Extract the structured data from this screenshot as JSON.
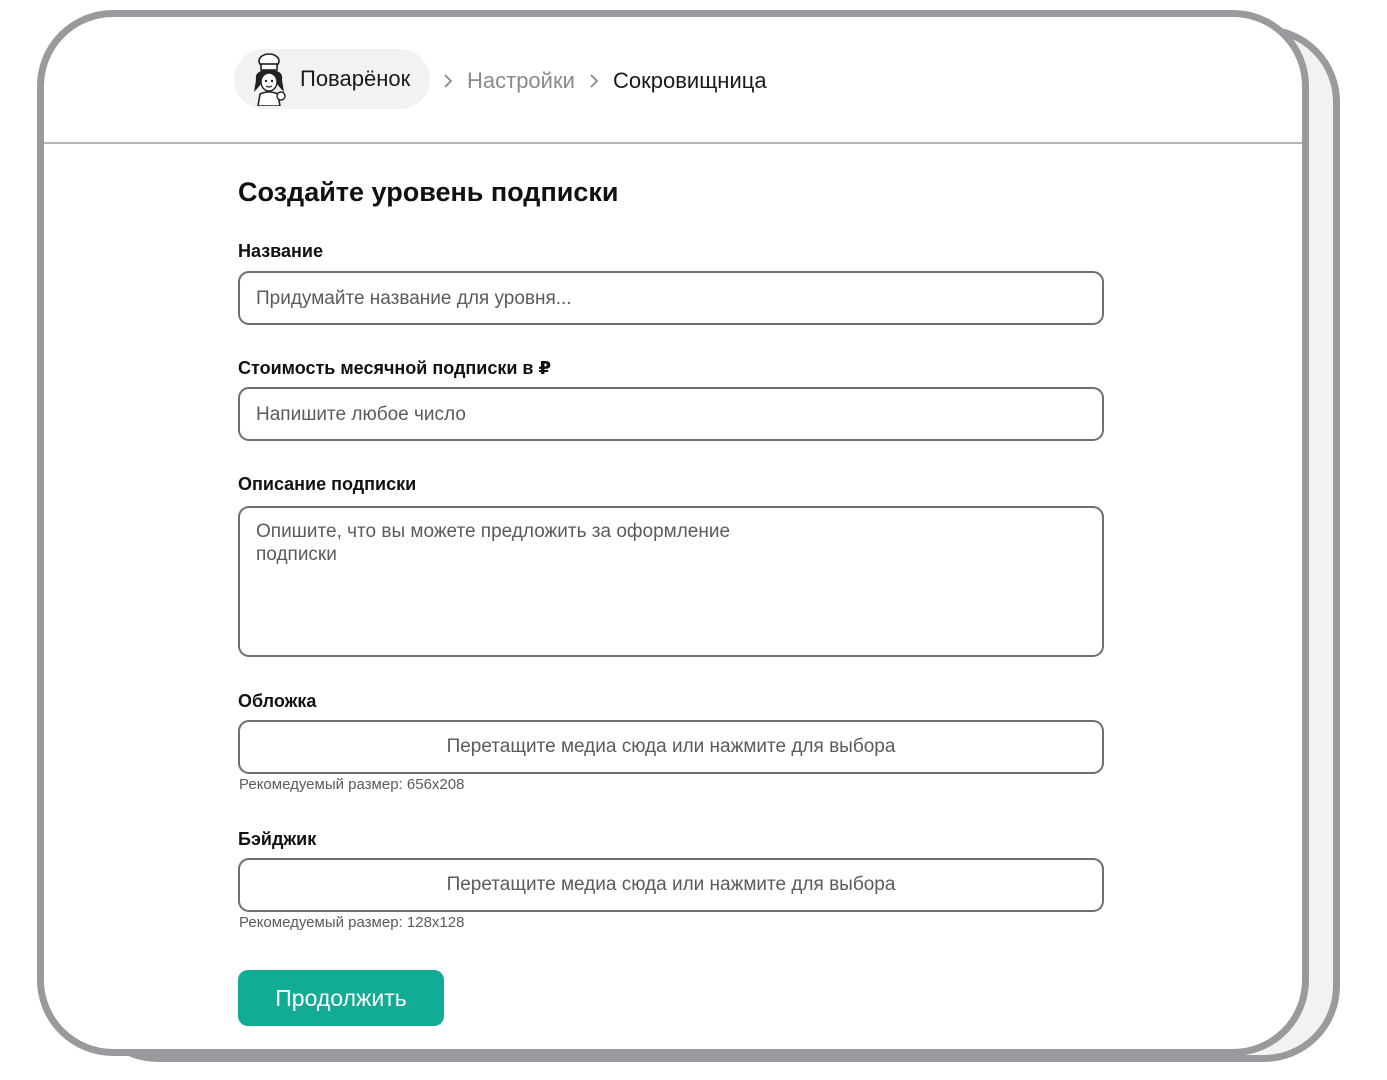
{
  "header": {
    "brand_name": "Поварёнок",
    "breadcrumb": [
      {
        "label": "Настройки"
      },
      {
        "label": "Сокровищница"
      }
    ]
  },
  "form": {
    "title": "Создайте уровень подписки",
    "name": {
      "label": "Название",
      "placeholder": "Придумайте название для уровня..."
    },
    "price": {
      "label": "Стоимость месячной подписки в ₽",
      "placeholder": "Напишите любое число"
    },
    "description": {
      "label": "Описание подписки",
      "placeholder": "Опишите, что вы можете предложить за оформление подписки"
    },
    "cover": {
      "label": "Обложка",
      "upload_text": "Перетащите медиа сюда или нажмите для выбора",
      "hint": "Рекомедуемый размер: 656x208"
    },
    "badge": {
      "label": "Бэйджик",
      "upload_text": "Перетащите медиа сюда или нажмите для выбора",
      "hint": "Рекомедуемый размер: 128x128"
    },
    "submit_label": "Продолжить"
  },
  "colors": {
    "accent": "#12ab94",
    "frame": "#9a9a9e",
    "text": "#111111",
    "muted": "#8a8a8e"
  },
  "icons": {
    "avatar": "chef-avatar-icon",
    "separator": "chevron-right-icon"
  }
}
